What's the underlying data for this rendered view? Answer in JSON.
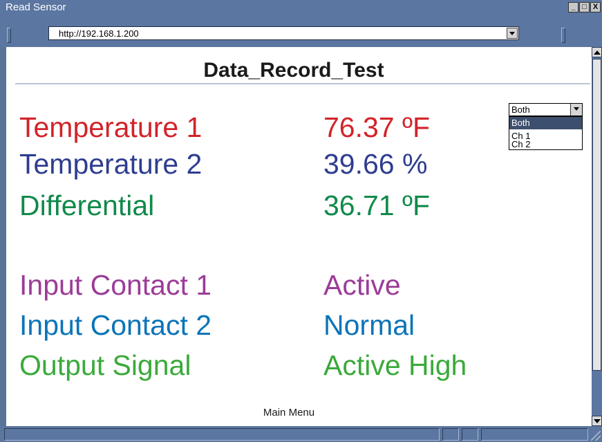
{
  "window": {
    "title": "Read Sensor",
    "controls": {
      "minimize": "_",
      "maximize": "□",
      "close": "X"
    }
  },
  "address_bar": {
    "url": "http://192.168.1.200"
  },
  "page": {
    "title": "Data_Record_Test",
    "readings": [
      {
        "label": "Temperature 1",
        "value": "76.37  ºF",
        "color": "#d2232a"
      },
      {
        "label": "Temperature 2",
        "value": "39.66  %",
        "color": "#2e3d8f"
      },
      {
        "label": "Differential",
        "value": "36.71  ºF",
        "color": "#108a4a"
      }
    ],
    "statuses": [
      {
        "label": "Input Contact 1",
        "value": "Active",
        "color": "#9c3c98"
      },
      {
        "label": "Input Contact 2",
        "value": "Normal",
        "color": "#0c74b8"
      },
      {
        "label": "Output Signal",
        "value": "Active High",
        "color": "#3aaa3a"
      }
    ],
    "channel_select": {
      "selected": "Both",
      "options": [
        "Both",
        "Ch 1",
        "Ch 2"
      ]
    },
    "footer_link": "Main Menu"
  },
  "colors": {
    "chrome": "#5b76a0",
    "selection": "#3d4f6e"
  },
  "icons": [
    "minimize-icon",
    "maximize-icon",
    "close-icon",
    "dropdown-arrow-icon",
    "scroll-up-icon",
    "scroll-down-icon",
    "resize-grip-icon"
  ]
}
